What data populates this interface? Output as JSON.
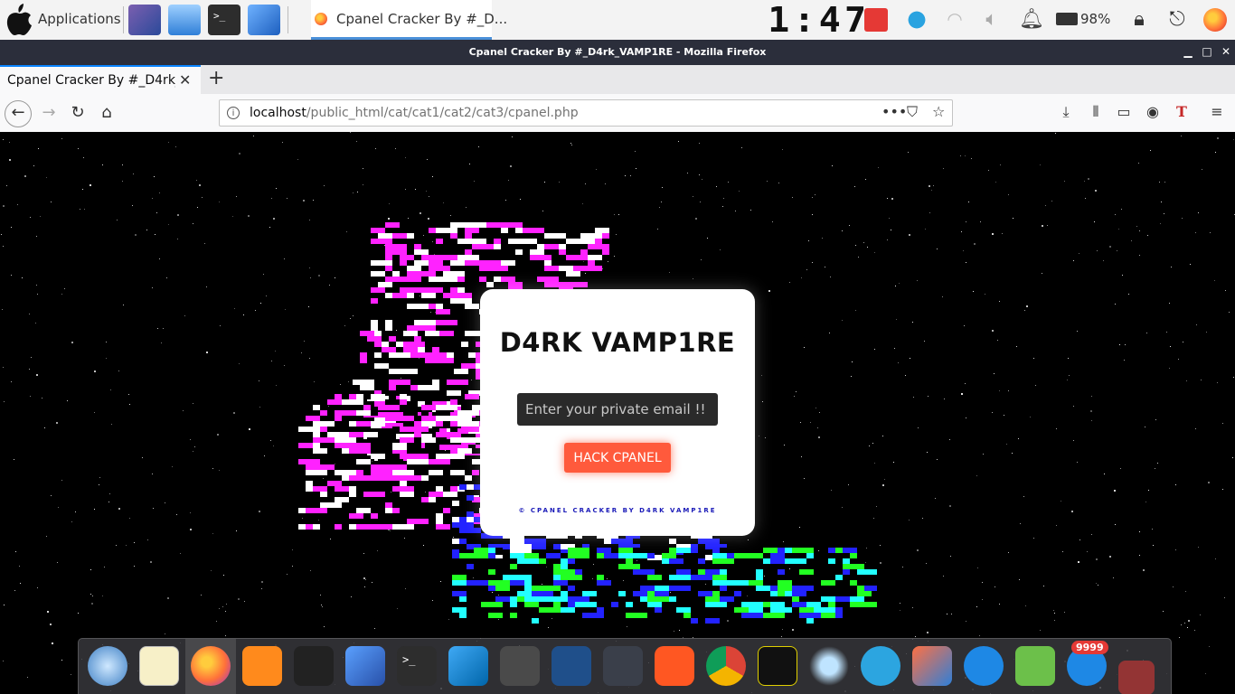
{
  "system_panel": {
    "apps_label": "Applications",
    "task_title": "Cpanel Cracker By #_D...",
    "clock": "1:47",
    "battery": "98%"
  },
  "window": {
    "title": "Cpanel Cracker By #_D4rk_VAMP1RE - Mozilla Firefox",
    "tab_label": "Cpanel Cracker By #_D4rk_",
    "url_host": "localhost",
    "url_path": "/public_html/cat/cat1/cat2/cat3/cpanel.php"
  },
  "page": {
    "heading": "D4RK VAMP1RE",
    "email_placeholder": "Enter your private email !!",
    "button_label": "HACK CPANEL",
    "footer": "© CPANEL CRACKER BY D4RK VAMP1RE"
  },
  "dock": {
    "badge": "9999"
  },
  "colors": {
    "button": "#ff5a3c",
    "footer_text": "#1a1ab8",
    "title_bar": "#2b2e3b",
    "tab_accent": "#0a84ff"
  }
}
